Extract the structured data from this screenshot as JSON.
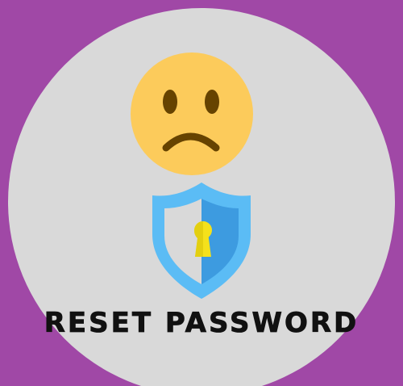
{
  "title": "RESET PASSWORD",
  "colors": {
    "background": "#A048A6",
    "circle": "#D9D9D9",
    "face": "#FCCB5B",
    "face_features": "#664300",
    "shield_light": "#5BBCF5",
    "shield_dark": "#3D9BE0",
    "keyhole": "#F5E11B",
    "text": "#111111"
  },
  "icons": [
    "sad-face-icon",
    "shield-keyhole-icon"
  ]
}
